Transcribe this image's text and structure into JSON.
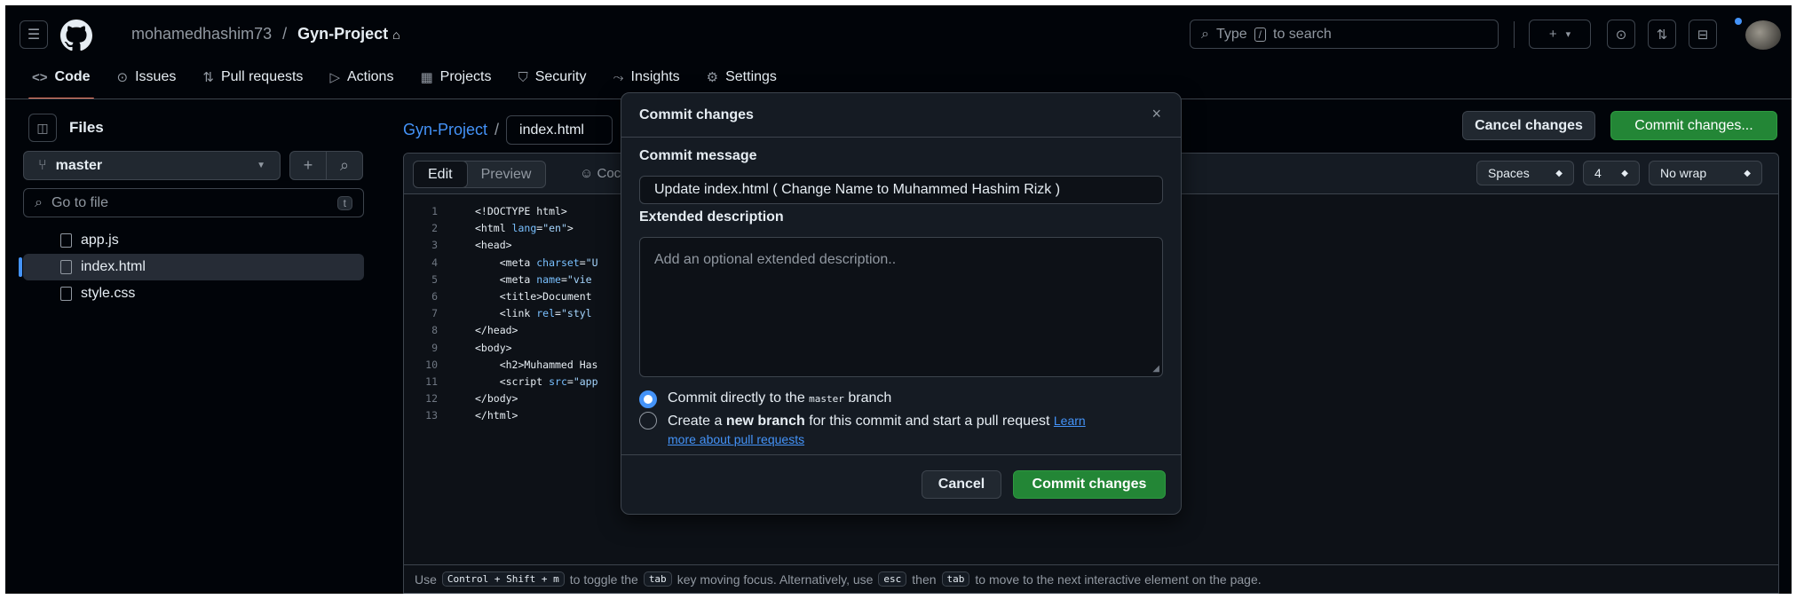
{
  "header": {
    "owner": "mohamedhashim73",
    "separator": "/",
    "repo": "Gyn-Project",
    "lock_glyph": "⌂",
    "search_prefix": "Type",
    "search_key": "/",
    "search_suffix": "to search",
    "plus_label": "+",
    "plus_caret": "▾",
    "accent_color": "#4493f8"
  },
  "tabs": [
    {
      "icon": "<>",
      "label": "Code"
    },
    {
      "icon": "⊙",
      "label": "Issues"
    },
    {
      "icon": "⇅",
      "label": "Pull requests"
    },
    {
      "icon": "▷",
      "label": "Actions"
    },
    {
      "icon": "▦",
      "label": "Projects"
    },
    {
      "icon": "⛉",
      "label": "Security"
    },
    {
      "icon": "⤳",
      "label": "Insights"
    },
    {
      "icon": "⚙",
      "label": "Settings"
    }
  ],
  "sidebar": {
    "title": "Files",
    "branch": "master",
    "go_to_file_placeholder": "Go to file",
    "go_to_file_key": "t",
    "files": [
      "app.js",
      "index.html",
      "style.css"
    ],
    "selected_file": "index.html"
  },
  "editor": {
    "repo_link": "Gyn-Project",
    "path_sep": "/",
    "filename": "index.html",
    "cancel_label": "Cancel changes",
    "commit_label": "Commit changes...",
    "edit_tab": "Edit",
    "preview_tab": "Preview",
    "copilot_label": "Coc",
    "indent_mode": "Spaces",
    "indent_size": "4",
    "wrap_mode": "No wrap",
    "line_numbers": [
      "1",
      "2",
      "3",
      "4",
      "5",
      "6",
      "7",
      "8",
      "9",
      "10",
      "11",
      "12",
      "13"
    ],
    "hint": {
      "use": "Use",
      "keys1": "Control + Shift + m",
      "mid1": "to toggle the",
      "key_tab": "tab",
      "mid2": "key moving focus. Alternatively, use",
      "key_esc": "esc",
      "then": "then",
      "key_tab2": "tab",
      "end": "to move to the next interactive element on the page."
    }
  },
  "modal": {
    "title": "Commit changes",
    "close_glyph": "×",
    "message_label": "Commit message",
    "message_value": "Update index.html ( Change Name to Muhammed Hashim Rizk )",
    "description_label": "Extended description",
    "description_placeholder": "Add an optional extended description..",
    "option1_prefix": "Commit directly to the",
    "option1_branch": "master",
    "option1_suffix": "branch",
    "option2_prefix": "Create a",
    "option2_bold": "new branch",
    "option2_suffix": "for this commit and start a pull request",
    "option2_link_a": "Learn",
    "option2_link_b": "more about pull requests",
    "cancel_label": "Cancel",
    "commit_label": "Commit changes",
    "commit_color": "#238636"
  }
}
